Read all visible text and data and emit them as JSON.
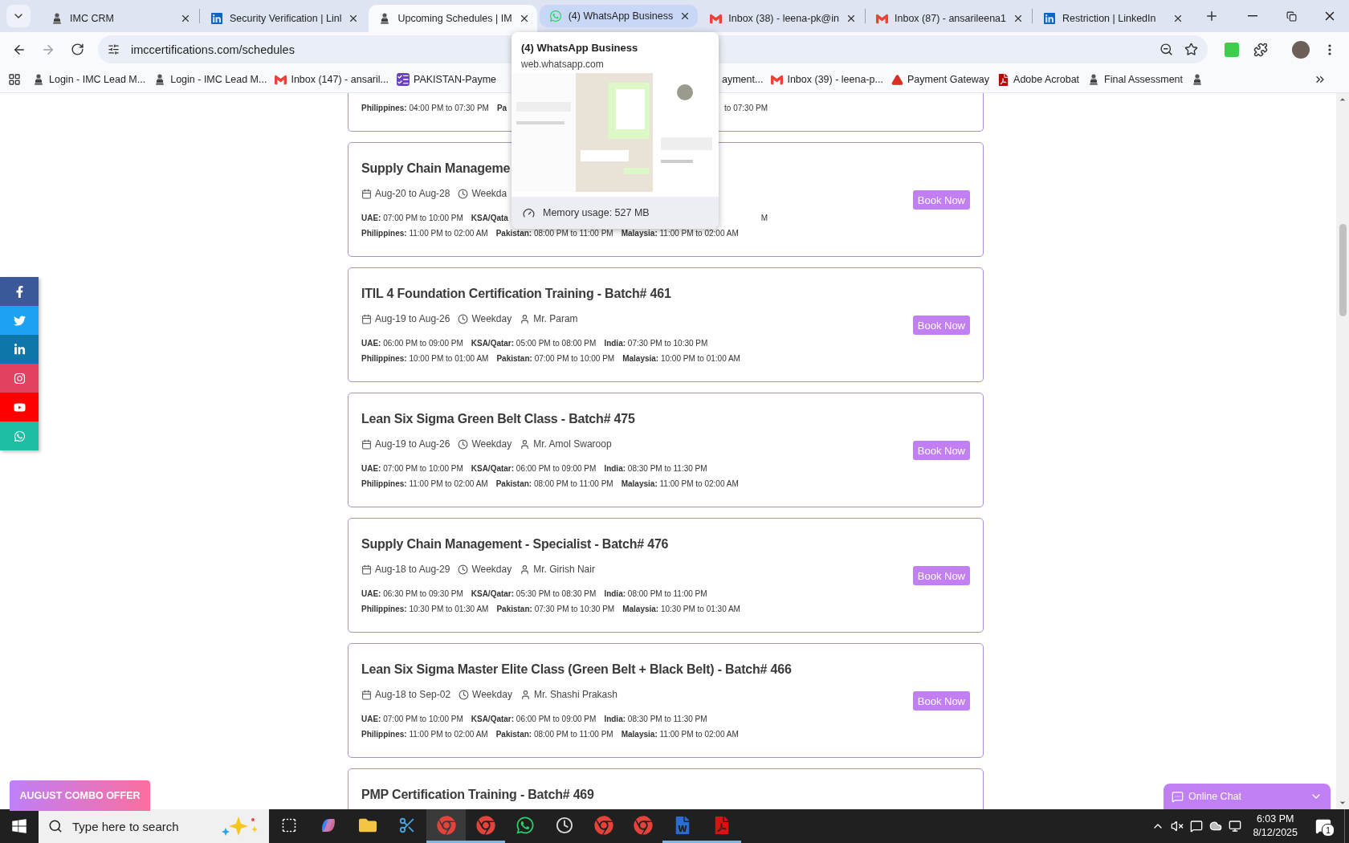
{
  "browser": {
    "tabs": [
      {
        "title": "IMC CRM",
        "kind": "imc",
        "selected": false,
        "hovered": false
      },
      {
        "title": "Security Verification | Linl",
        "kind": "linkedin",
        "selected": false,
        "hovered": false
      },
      {
        "title": "Upcoming Schedules | IM",
        "kind": "imc",
        "selected": true,
        "hovered": false
      },
      {
        "title": "(4) WhatsApp Business",
        "kind": "whatsapp",
        "selected": false,
        "hovered": true
      },
      {
        "title": "Inbox (38) - leena-pk@in",
        "kind": "gmail",
        "selected": false,
        "hovered": false
      },
      {
        "title": "Inbox (87) - ansarileena1",
        "kind": "gmail",
        "selected": false,
        "hovered": false
      },
      {
        "title": "Restriction | LinkedIn",
        "kind": "linkedin",
        "selected": false,
        "hovered": false
      }
    ],
    "address_bar": {
      "url": "imccertifications.com/schedules"
    },
    "bookmarks_bar": {
      "left": [
        {
          "title": "Login - IMC Lead M...",
          "kind": "imc"
        },
        {
          "title": "Login - IMC Lead M...",
          "kind": "imc"
        },
        {
          "title": "Inbox (147) - ansaril...",
          "kind": "gmail"
        },
        {
          "title": "PAKISTAN-Payme",
          "kind": "list"
        }
      ],
      "right": [
        {
          "title": "ayment...",
          "kind": "none"
        },
        {
          "title": "Inbox (39) - leena-p...",
          "kind": "gmail"
        },
        {
          "title": "Payment Gateway",
          "kind": "triangle"
        },
        {
          "title": "Adobe Acrobat",
          "kind": "pdf"
        },
        {
          "title": "Final Assessment",
          "kind": "imc"
        },
        {
          "kind": "imc"
        }
      ]
    },
    "tab_preview": {
      "title": "(4) WhatsApp Business",
      "url": "web.whatsapp.com",
      "memory": "Memory usage: 527 MB"
    }
  },
  "social_bar": [
    {
      "kind": "facebook",
      "color": "#3b5998"
    },
    {
      "kind": "twitter",
      "color": "#1da1f2"
    },
    {
      "kind": "linkedin",
      "color": "#0e76a8"
    },
    {
      "kind": "instagram",
      "color": "#e4405f"
    },
    {
      "kind": "youtube",
      "color": "#ff0000"
    },
    {
      "kind": "whatsapp",
      "color": "#1ebea5"
    }
  ],
  "schedules": [
    {
      "kind": "clipped",
      "timings": [
        [
          {
            "kind": "slot",
            "text": "**Philippines:** 04:00 PM to 07:30 PM"
          },
          {
            "kind": "slot",
            "text": "**Pa**"
          },
          {
            "kind": "tail",
            "text": "to 07:30 PM"
          }
        ]
      ]
    },
    {
      "kind": "full",
      "title": "Supply Chain Manageme",
      "date": "Aug-20 to Aug-28",
      "schedule": "Weekda",
      "timings": [
        [
          {
            "kind": "slot",
            "text": "**UAE:** 07:00 PM to 10:00 PM"
          },
          {
            "kind": "slot",
            "text": "**KSA/Qata**"
          },
          {
            "kind": "tail",
            "text": "M"
          }
        ],
        [
          {
            "kind": "slot",
            "text": "**Philippines:** 11:00 PM to 02:00 AM"
          },
          {
            "kind": "slot",
            "text": "**Pakistan:** 08:00 PM to 11:00 PM"
          },
          {
            "kind": "slot",
            "text": "**Malaysia:** 11:00 PM to 02:00 AM"
          }
        ]
      ],
      "button": "Book Now"
    },
    {
      "kind": "full",
      "title": "ITIL 4 Foundation Certification Training - Batch# 461",
      "date": "Aug-19 to Aug-26",
      "schedule": "Weekday",
      "trainer": "Mr. Param",
      "timings": [
        [
          {
            "kind": "slot",
            "text": "**UAE:** 06:00 PM to 09:00 PM"
          },
          {
            "kind": "slot",
            "text": "**KSA/Qatar:** 05:00 PM to 08:00 PM"
          },
          {
            "kind": "slot",
            "text": "**India:** 07:30 PM to 10:30 PM"
          }
        ],
        [
          {
            "kind": "slot",
            "text": "**Philippines:** 10:00 PM to 01:00 AM"
          },
          {
            "kind": "slot",
            "text": "**Pakistan:** 07:00 PM to 10:00 PM"
          },
          {
            "kind": "slot",
            "text": "**Malaysia:** 10:00 PM to 01:00 AM"
          }
        ]
      ],
      "button": "Book Now"
    },
    {
      "kind": "full",
      "title": "Lean Six Sigma Green Belt Class - Batch# 475",
      "date": "Aug-19 to Aug-26",
      "schedule": "Weekday",
      "trainer": "Mr. Amol Swaroop",
      "timings": [
        [
          {
            "kind": "slot",
            "text": "**UAE:** 07:00 PM to 10:00 PM"
          },
          {
            "kind": "slot",
            "text": "**KSA/Qatar:** 06:00 PM to 09:00 PM"
          },
          {
            "kind": "slot",
            "text": "**India:** 08:30 PM to 11:30 PM"
          }
        ],
        [
          {
            "kind": "slot",
            "text": "**Philippines:** 11:00 PM to 02:00 AM"
          },
          {
            "kind": "slot",
            "text": "**Pakistan:** 08:00 PM to 11:00 PM"
          },
          {
            "kind": "slot",
            "text": "**Malaysia:** 11:00 PM to 02:00 AM"
          }
        ]
      ],
      "button": "Book Now"
    },
    {
      "kind": "full",
      "title": "Supply Chain Management - Specialist - Batch# 476",
      "date": "Aug-18 to Aug-29",
      "schedule": "Weekday",
      "trainer": "Mr. Girish Nair",
      "timings": [
        [
          {
            "kind": "slot",
            "text": "**UAE:** 06:30 PM to 09:30 PM"
          },
          {
            "kind": "slot",
            "text": "**KSA/Qatar:** 05:30 PM to 08:30 PM"
          },
          {
            "kind": "slot",
            "text": "**India:** 08:00 PM to 11:00 PM"
          }
        ],
        [
          {
            "kind": "slot",
            "text": "**Philippines:** 10:30 PM to 01:30 AM"
          },
          {
            "kind": "slot",
            "text": "**Pakistan:** 07:30 PM to 10:30 PM"
          },
          {
            "kind": "slot",
            "text": "**Malaysia:** 10:30 PM to 01:30 AM"
          }
        ]
      ],
      "button": "Book Now"
    },
    {
      "kind": "full",
      "title": "Lean Six Sigma Master Elite Class (Green Belt + Black Belt) - Batch# 466",
      "date": "Aug-18 to Sep-02",
      "schedule": "Weekday",
      "trainer": "Mr. Shashi Prakash",
      "timings": [
        [
          {
            "kind": "slot",
            "text": "**UAE:** 07:00 PM to 10:00 PM"
          },
          {
            "kind": "slot",
            "text": "**KSA/Qatar:** 06:00 PM to 09:00 PM"
          },
          {
            "kind": "slot",
            "text": "**India:** 08:30 PM to 11:30 PM"
          }
        ],
        [
          {
            "kind": "slot",
            "text": "**Philippines:** 11:00 PM to 02:00 AM"
          },
          {
            "kind": "slot",
            "text": "**Pakistan:** 08:00 PM to 11:00 PM"
          },
          {
            "kind": "slot",
            "text": "**Malaysia:** 11:00 PM to 02:00 AM"
          }
        ]
      ],
      "button": "Book Now"
    },
    {
      "kind": "full",
      "title": "PMP Certification Training - Batch# 469"
    }
  ],
  "offer_button": "AUGUST COMBO OFFER",
  "chat_widget": {
    "label": "Online Chat"
  },
  "taskbar": {
    "search_placeholder": "Type here to search",
    "apps": [
      {
        "kind": "taskview",
        "active": false,
        "running": false
      },
      {
        "kind": "copilot",
        "active": false,
        "running": false
      },
      {
        "kind": "files",
        "active": false,
        "running": false
      },
      {
        "kind": "snip",
        "active": false,
        "running": false
      },
      {
        "kind": "chrome",
        "active": true,
        "running": true
      },
      {
        "kind": "chrome",
        "active": false,
        "running": true
      },
      {
        "kind": "whatsapp",
        "active": false,
        "running": false
      },
      {
        "kind": "clock",
        "active": false,
        "running": false
      },
      {
        "kind": "chrome",
        "active": false,
        "running": false
      },
      {
        "kind": "chrome",
        "active": false,
        "running": false
      },
      {
        "kind": "word",
        "active": false,
        "running": true
      },
      {
        "kind": "pdf",
        "active": false,
        "running": true
      }
    ],
    "time": "6:03 PM",
    "date": "8/12/2025",
    "notifications": "1"
  }
}
